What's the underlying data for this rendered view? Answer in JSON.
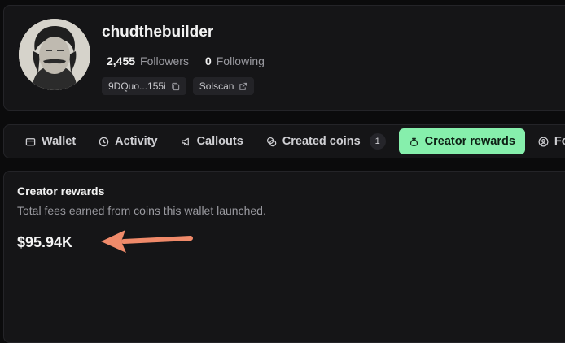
{
  "profile": {
    "username": "chudthebuilder",
    "followers_count": "2,455",
    "followers_label": "Followers",
    "following_count": "0",
    "following_label": "Following",
    "wallet_short": "9DQuo...155i",
    "solscan_label": "Solscan"
  },
  "tabs": [
    {
      "label": "Wallet",
      "icon": "wallet-icon"
    },
    {
      "label": "Activity",
      "icon": "clock-icon"
    },
    {
      "label": "Callouts",
      "icon": "megaphone-icon"
    },
    {
      "label": "Created coins",
      "icon": "coins-icon",
      "badge": "1"
    },
    {
      "label": "Creator rewards",
      "icon": "money-bag-icon",
      "active": true
    },
    {
      "label": "Follo",
      "icon": "user-icon"
    }
  ],
  "rewards": {
    "title": "Creator rewards",
    "description": "Total fees earned from coins this wallet launched.",
    "amount": "$95.94K"
  },
  "colors": {
    "accent": "#86efac",
    "arrow": "#f08a6a",
    "background": "#0b0b0c",
    "card": "#151517"
  }
}
